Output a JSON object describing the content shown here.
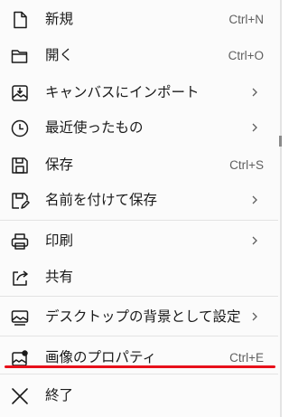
{
  "menu": {
    "items": [
      {
        "label": "新規",
        "shortcut": "Ctrl+N",
        "icon": "new-file-icon"
      },
      {
        "label": "開く",
        "shortcut": "Ctrl+O",
        "icon": "open-folder-icon"
      },
      {
        "label": "キャンバスにインポート",
        "shortcut": "",
        "icon": "import-to-canvas-icon",
        "submenu": true
      },
      {
        "label": "最近使ったもの",
        "shortcut": "",
        "icon": "clock-icon",
        "submenu": true
      },
      {
        "label": "保存",
        "shortcut": "Ctrl+S",
        "icon": "save-icon"
      },
      {
        "label": "名前を付けて保存",
        "shortcut": "",
        "icon": "save-as-icon",
        "submenu": true
      },
      {
        "label": "印刷",
        "shortcut": "",
        "icon": "print-icon",
        "submenu": true
      },
      {
        "label": "共有",
        "shortcut": "",
        "icon": "share-icon"
      },
      {
        "label": "デスクトップの背景として設定",
        "shortcut": "",
        "icon": "desktop-background-icon",
        "submenu": true
      },
      {
        "label": "画像のプロパティ",
        "shortcut": "Ctrl+E",
        "icon": "image-properties-icon"
      },
      {
        "label": "終了",
        "shortcut": "",
        "icon": "close-icon"
      }
    ]
  },
  "colors": {
    "background": "#fbfbfb",
    "text": "#1b1b1b",
    "shortcut": "#5f5f5f",
    "separator": "#e3e3e3",
    "annotation": "#e8101a"
  }
}
